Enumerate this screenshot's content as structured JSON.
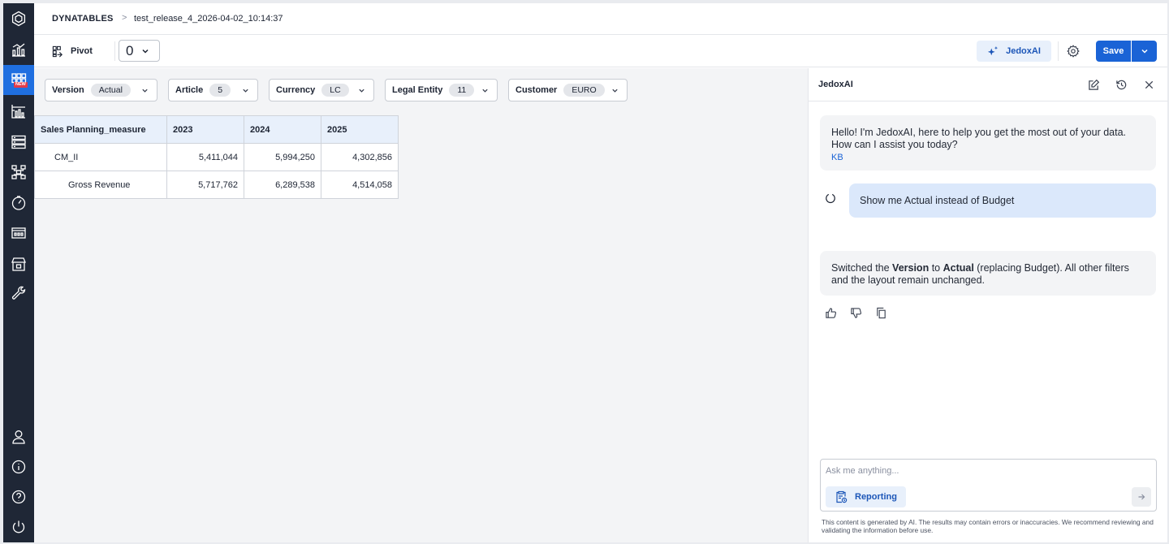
{
  "breadcrumb": {
    "root": "DYNATABLES",
    "separator": ">",
    "current": "test_release_4_2026-04-02_10:14:37"
  },
  "rail": {
    "new_badge": "NEW",
    "top_icons": [
      "logo-hexagon-icon",
      "analytics-chart-icon",
      "dynatables-grid-icon",
      "reports-bar-icon",
      "database-stack-icon",
      "hierarchy-icon",
      "gauge-icon",
      "marketplace-icon",
      "store-icon",
      "wrench-icon"
    ],
    "bottom_icons": [
      "user-icon",
      "info-icon",
      "help-icon",
      "power-icon"
    ]
  },
  "toolbar": {
    "pivot_label": "Pivot",
    "zero_value": "0",
    "jedox_label": "JedoxAI",
    "save_label": "Save"
  },
  "filters": [
    {
      "label": "Version",
      "value": "Actual"
    },
    {
      "label": "Article",
      "value": "5"
    },
    {
      "label": "Currency",
      "value": "LC"
    },
    {
      "label": "Legal Entity",
      "value": "11"
    },
    {
      "label": "Customer",
      "value": "EURO"
    }
  ],
  "table": {
    "header": [
      "Sales Planning_measure",
      "2023",
      "2024",
      "2025"
    ],
    "rows": [
      {
        "label": "CM_II",
        "values": [
          "5,411,044",
          "5,994,250",
          "4,302,856"
        ]
      },
      {
        "label": "Gross Revenue",
        "values": [
          "5,717,762",
          "6,289,538",
          "4,514,058"
        ]
      }
    ]
  },
  "panel": {
    "title": "JedoxAI",
    "greeting": "Hello! I'm JedoxAI, here to help you get the most out of your data. How can I assist you today?",
    "greeting_tag": "KB",
    "user_message": "Show me Actual instead of Budget",
    "reply": {
      "p1": "Switched the ",
      "b1": "Version",
      "p2": " to ",
      "b2": "Actual",
      "p3": " (replacing Budget). All other filters and the layout remain unchanged."
    },
    "input_placeholder": "Ask me anything...",
    "reporting_label": "Reporting",
    "disclaimer": "This content is generated by AI. The results may contain errors or inaccuracies. We recommend reviewing and validating the information before use."
  },
  "colors": {
    "rail_bg": "#1f2736",
    "accent": "#1a63d6",
    "header_cell_bg": "#e8f0fb",
    "user_bubble": "#dbe8fb"
  }
}
